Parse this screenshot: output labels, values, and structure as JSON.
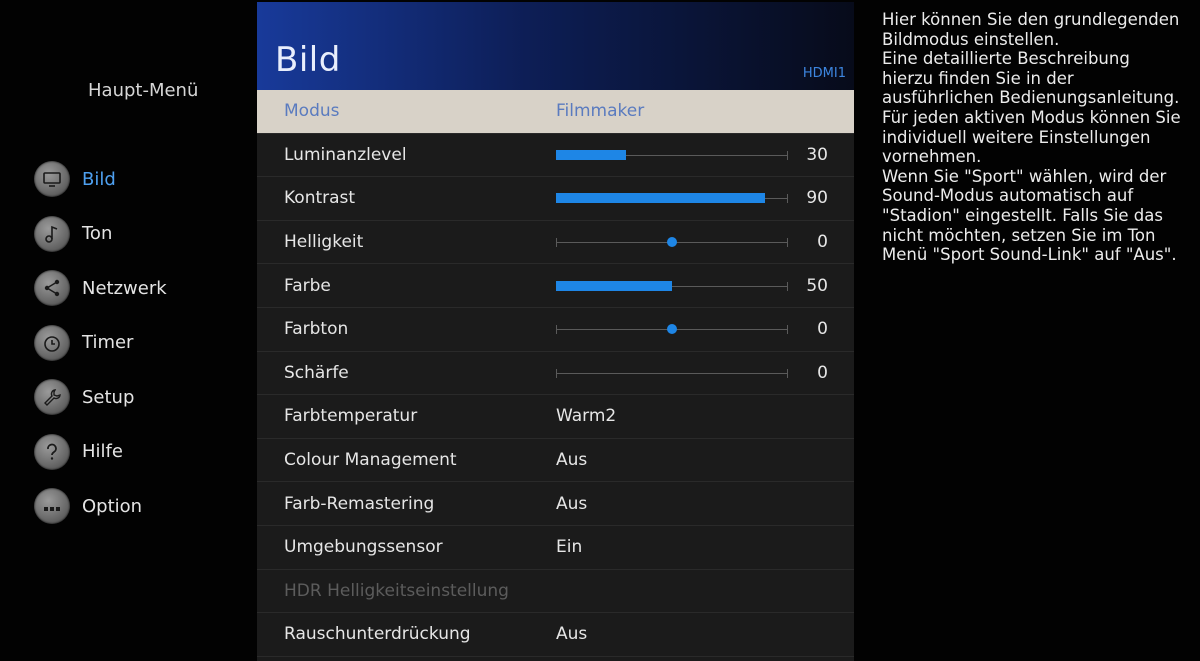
{
  "main_menu": {
    "title": "Haupt-Menü",
    "items": [
      {
        "label": "Bild",
        "icon": "tv-icon",
        "active": true
      },
      {
        "label": "Ton",
        "icon": "music-note-icon",
        "active": false
      },
      {
        "label": "Netzwerk",
        "icon": "share-network-icon",
        "active": false
      },
      {
        "label": "Timer",
        "icon": "clock-icon",
        "active": false
      },
      {
        "label": "Setup",
        "icon": "wrench-icon",
        "active": false
      },
      {
        "label": "Hilfe",
        "icon": "question-mark-icon",
        "active": false
      },
      {
        "label": "Option",
        "icon": "dots-icon",
        "active": false
      }
    ]
  },
  "panel": {
    "title": "Bild",
    "source": "HDMI1",
    "rows": [
      {
        "label": "Modus",
        "value": "Filmmaker",
        "selected": true
      },
      {
        "label": "Luminanzlevel",
        "number": "30",
        "level": 0.3
      },
      {
        "label": "Kontrast",
        "number": "90",
        "level": 0.9
      },
      {
        "label": "Helligkeit",
        "number": "0",
        "level": 0.5
      },
      {
        "label": "Farbe",
        "number": "50",
        "level": 0.5
      },
      {
        "label": "Farbton",
        "number": "0",
        "level": 0.5
      },
      {
        "label": "Schärfe",
        "number": "0",
        "level": 0.0
      },
      {
        "label": "Farbtemperatur",
        "value": "Warm2"
      },
      {
        "label": "Colour Management",
        "value": "Aus"
      },
      {
        "label": "Farb-Remastering",
        "value": "Aus"
      },
      {
        "label": "Umgebungssensor",
        "value": "Ein"
      },
      {
        "label": "HDR Helligkeitseinstellung",
        "value": "",
        "disabled": true
      },
      {
        "label": "Rauschunterdrückung",
        "value": "Aus"
      }
    ]
  },
  "help": {
    "paragraphs": [
      "Hier können Sie den grundlegenden Bildmodus einstellen.",
      "Eine detaillierte Beschreibung hierzu finden Sie in der ausführlichen Bedienungsanleitung.",
      "Für jeden aktiven Modus können Sie individuell weitere Einstellungen vornehmen.",
      "Wenn Sie \"Sport\" wählen, wird der Sound-Modus automatisch auf \"Stadion\" eingestellt. Falls Sie das nicht möchten, setzen Sie im Ton Menü \"Sport Sound-Link\" auf \"Aus\"."
    ]
  },
  "colors": {
    "accent": "#1e86e6",
    "active_nav": "#4ea0f0",
    "selected_row_bg": "#d8d2c8"
  }
}
